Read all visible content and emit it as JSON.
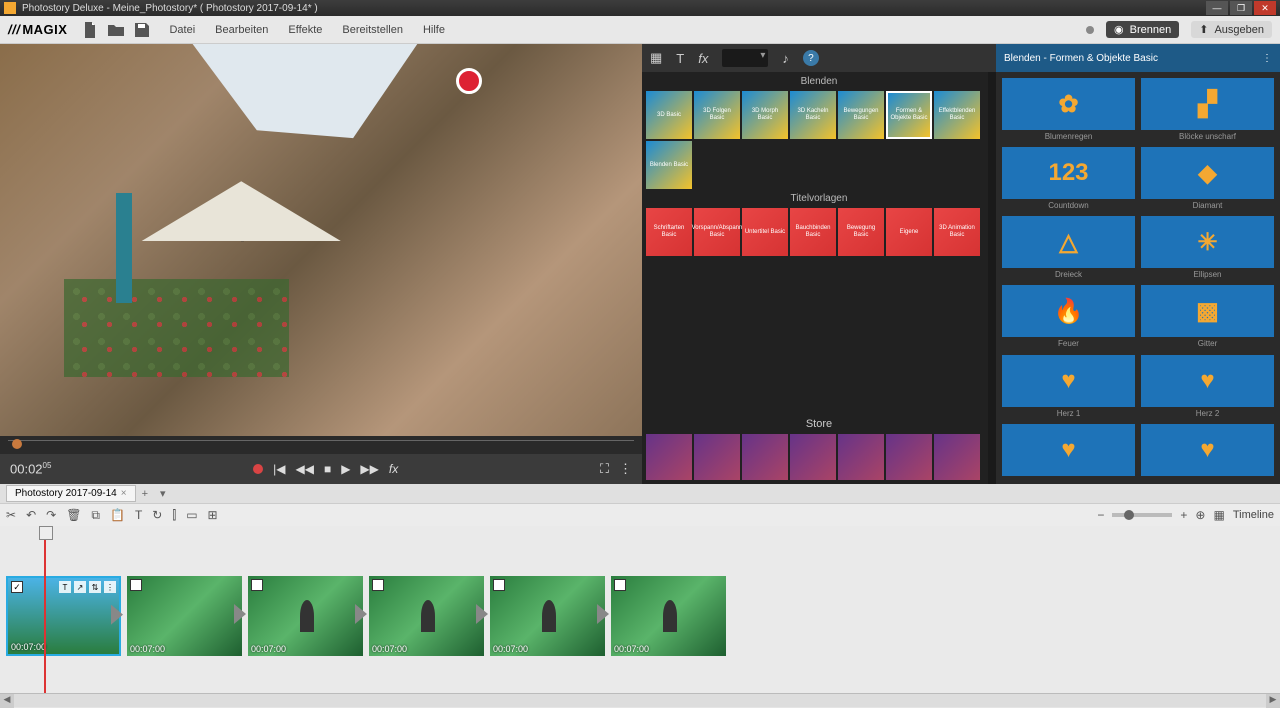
{
  "titlebar": {
    "title": "Photostory Deluxe - Meine_Photostory* ( Photostory 2017-09-14* )"
  },
  "menubar": {
    "logo": "MAGIX",
    "items": [
      "Datei",
      "Bearbeiten",
      "Effekte",
      "Bereitstellen",
      "Hilfe"
    ],
    "burn": "Brennen",
    "export": "Ausgeben"
  },
  "preview": {
    "timecode_main": "00:02",
    "timecode_frames": "05"
  },
  "media": {
    "section_transitions": "Blenden",
    "section_titles": "Titelvorlagen",
    "section_store": "Store",
    "transitions": [
      "3D Basic",
      "3D Folgen Basic",
      "3D Morph Basic",
      "3D Kacheln Basic",
      "Bewegungen Basic",
      "Formen & Objekte Basic",
      "Effektblenden Basic",
      "Blenden Basic"
    ],
    "titles": [
      "Schriftarten Basic",
      "Vorspann/Abspann Basic",
      "Untertitel Basic",
      "Bauchbinden Basic",
      "Bewegung Basic",
      "Eigene",
      "3D Animation Basic"
    ]
  },
  "side": {
    "header": "Blenden - Formen & Objekte Basic",
    "items": [
      {
        "label": "Blumenregen",
        "icon": "✿"
      },
      {
        "label": "Blöcke unscharf",
        "icon": "▞"
      },
      {
        "label": "Countdown",
        "icon": "123"
      },
      {
        "label": "Diamant",
        "icon": "◆"
      },
      {
        "label": "Dreieck",
        "icon": "△"
      },
      {
        "label": "Ellipsen",
        "icon": "✳"
      },
      {
        "label": "Feuer",
        "icon": "🔥"
      },
      {
        "label": "Gitter",
        "icon": "▩"
      },
      {
        "label": "Herz 1",
        "icon": "♥"
      },
      {
        "label": "Herz 2",
        "icon": "♥"
      },
      {
        "label": "",
        "icon": "♥"
      },
      {
        "label": "",
        "icon": "♥"
      }
    ]
  },
  "timeline": {
    "tab": "Photostory 2017-09-14",
    "view_label": "Timeline",
    "clips": [
      {
        "duration": "00:07:00",
        "checked": true,
        "first": true
      },
      {
        "duration": "00:07:00"
      },
      {
        "duration": "00:07:00"
      },
      {
        "duration": "00:07:00"
      },
      {
        "duration": "00:07:00"
      },
      {
        "duration": "00:07:00"
      }
    ]
  }
}
